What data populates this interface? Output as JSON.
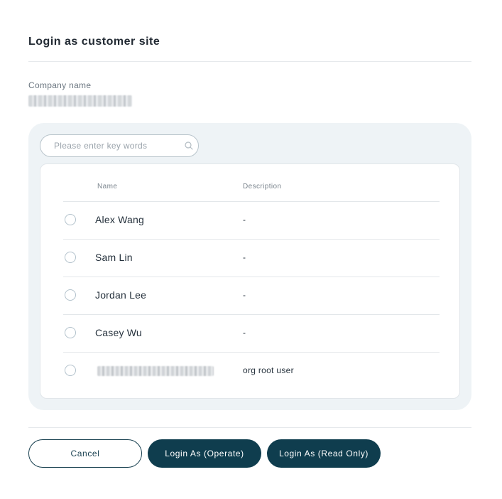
{
  "dialog": {
    "title": "Login as customer site",
    "company_label": "Company name"
  },
  "search": {
    "placeholder": "Please enter key words",
    "value": ""
  },
  "table": {
    "headers": {
      "name": "Name",
      "description": "Description"
    },
    "rows": [
      {
        "name": "Alex Wang",
        "description": "-"
      },
      {
        "name": "Sam Lin",
        "description": "-"
      },
      {
        "name": "Jordan Lee",
        "description": "-"
      },
      {
        "name": "Casey Wu",
        "description": "-"
      },
      {
        "name": "",
        "description": "org root user"
      }
    ]
  },
  "buttons": {
    "cancel": "Cancel",
    "login_operate": "Login As (Operate)",
    "login_read_only": "Login As (Read Only)"
  },
  "colors": {
    "primary": "#0f3d4e",
    "panel_bg": "#eef3f6",
    "border": "#e3e7ea"
  },
  "icons": {
    "search": "search-icon",
    "radio": "radio-unchecked-icon"
  }
}
